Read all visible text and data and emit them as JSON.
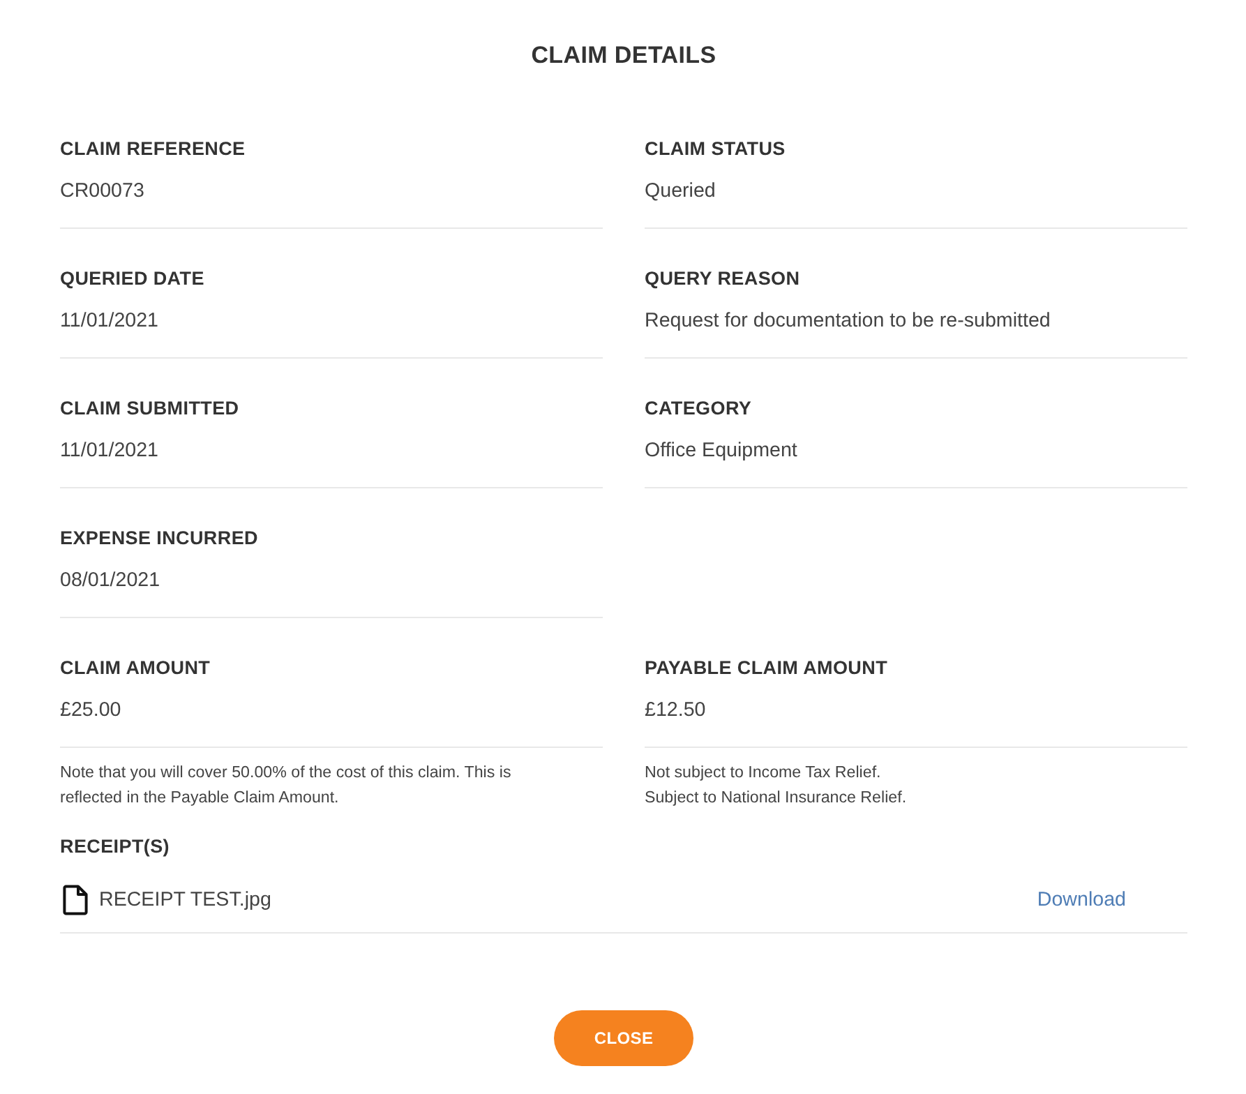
{
  "dialog": {
    "title": "CLAIM DETAILS"
  },
  "field_rows": [
    [
      {
        "label": "CLAIM REFERENCE",
        "value": "CR00073"
      },
      {
        "label": "CLAIM STATUS",
        "value": "Queried"
      }
    ],
    [
      {
        "label": "QUERIED DATE",
        "value": "11/01/2021"
      },
      {
        "label": "QUERY REASON",
        "value": "Request for documentation to be re-submitted"
      }
    ],
    [
      {
        "label": "CLAIM SUBMITTED",
        "value": "11/01/2021"
      },
      {
        "label": "CATEGORY",
        "value": "Office Equipment"
      }
    ],
    [
      {
        "label": "EXPENSE INCURRED",
        "value": "08/01/2021"
      }
    ],
    [
      {
        "label": "CLAIM AMOUNT",
        "value": "£25.00"
      },
      {
        "label": "PAYABLE CLAIM AMOUNT",
        "value": "£12.50"
      }
    ]
  ],
  "notes": [
    {
      "lines": [
        "Note that you will cover 50.00% of the cost of this claim. This is reflected in the Payable Claim Amount."
      ]
    },
    {
      "lines": [
        "Not subject to Income Tax Relief.",
        "Subject to National Insurance Relief."
      ]
    }
  ],
  "receipts": {
    "heading": "RECEIPT(S)",
    "files": [
      {
        "name": "RECEIPT TEST.jpg",
        "action": "Download"
      }
    ]
  },
  "close_button": {
    "label": "CLOSE"
  }
}
